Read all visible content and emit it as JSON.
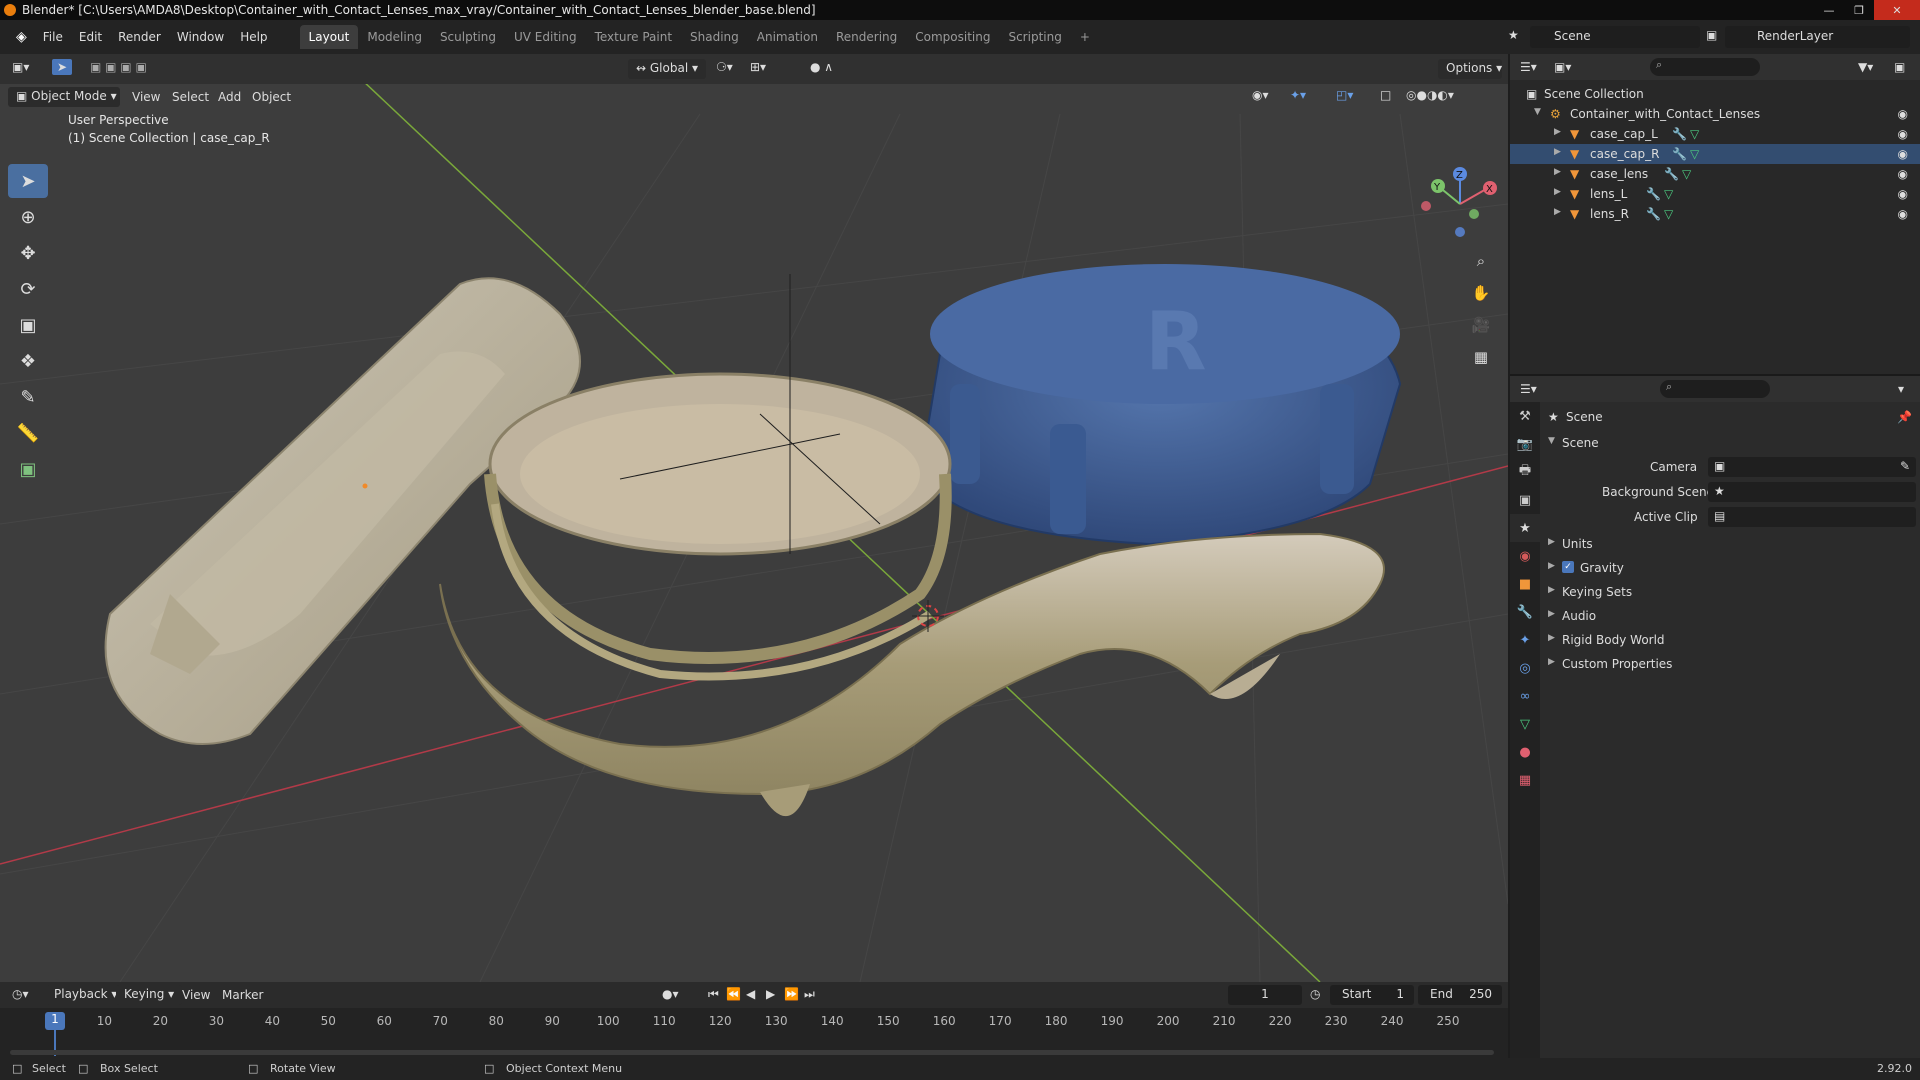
{
  "window": {
    "title": "Blender* [C:\\Users\\AMDA8\\Desktop\\Container_with_Contact_Lenses_max_vray/Container_with_Contact_Lenses_blender_base.blend]"
  },
  "menu": [
    "File",
    "Edit",
    "Render",
    "Window",
    "Help"
  ],
  "workspaces": [
    "Layout",
    "Modeling",
    "Sculpting",
    "UV Editing",
    "Texture Paint",
    "Shading",
    "Animation",
    "Rendering",
    "Compositing",
    "Scripting"
  ],
  "active_workspace": "Layout",
  "scene_name": "Scene",
  "view_layer": "RenderLayer",
  "viewport": {
    "transform_orientation": "Global",
    "options_label": "Options",
    "mode": "Object Mode",
    "header_menus": [
      "View",
      "Select",
      "Add",
      "Object"
    ],
    "info_line1": "User Perspective",
    "info_line2": "(1) Scene Collection | case_cap_R",
    "gizmo_axes": [
      "Z",
      "Y",
      "X"
    ],
    "lid_letter": "R"
  },
  "outliner": {
    "root": "Scene Collection",
    "collection": "Container_with_Contact_Lenses",
    "objects": [
      "case_cap_L",
      "case_cap_R",
      "case_lens",
      "lens_L",
      "lens_R"
    ],
    "selected": "case_cap_R"
  },
  "properties": {
    "panel_title": "Scene",
    "section": "Scene",
    "fields": {
      "camera": "Camera",
      "background_scene": "Background Scene",
      "active_clip": "Active Clip"
    },
    "subpanels": [
      "Units",
      "Gravity",
      "Keying Sets",
      "Audio",
      "Rigid Body World",
      "Custom Properties"
    ],
    "gravity_checked": true
  },
  "timeline": {
    "menus": [
      "Playback",
      "Keying",
      "View",
      "Marker"
    ],
    "current_frame": "1",
    "start_label": "Start",
    "start": "1",
    "end_label": "End",
    "end": "250",
    "ticks": [
      "10",
      "20",
      "30",
      "40",
      "50",
      "60",
      "70",
      "80",
      "90",
      "100",
      "110",
      "120",
      "130",
      "140",
      "150",
      "160",
      "170",
      "180",
      "190",
      "200",
      "210",
      "220",
      "230",
      "240",
      "250"
    ]
  },
  "statusbar": {
    "select": "Select",
    "box_select": "Box Select",
    "rotate_view": "Rotate View",
    "context_menu": "Object Context Menu",
    "version": "2.92.0"
  },
  "colors": {
    "accent": "#4a77bb",
    "selected_row": "#334d70",
    "cap_blue": "#3e5f96",
    "viewport_bg": "#3d3d3d",
    "x_axis": "#b23a48",
    "y_axis": "#7aa83a"
  }
}
